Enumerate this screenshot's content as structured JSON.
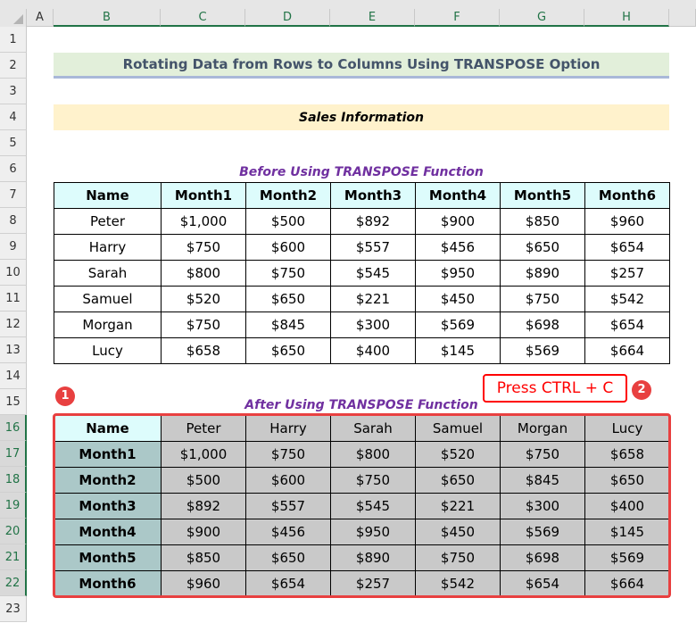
{
  "columns": [
    "A",
    "B",
    "C",
    "D",
    "E",
    "F",
    "G",
    "H"
  ],
  "rows": [
    "1",
    "2",
    "3",
    "4",
    "5",
    "6",
    "7",
    "8",
    "9",
    "10",
    "11",
    "12",
    "13",
    "14",
    "15",
    "16",
    "17",
    "18",
    "19",
    "20",
    "21",
    "22",
    "23"
  ],
  "title": "Rotating Data from Rows to Columns Using TRANSPOSE Option",
  "subtitle": "Sales Information",
  "before_caption": "Before Using TRANSPOSE Function",
  "after_caption": "After Using TRANSPOSE Function",
  "callout": "Press CTRL + C",
  "badges": [
    "1",
    "2"
  ],
  "colors": {
    "accent_red": "#e84040",
    "caption": "#7030a0",
    "header_bg": "#ddfcfc",
    "selected_bg": "#c9c9c9",
    "selected_first_col": "#abc8c8"
  },
  "before_table": {
    "headers": [
      "Name",
      "Month1",
      "Month2",
      "Month3",
      "Month4",
      "Month5",
      "Month6"
    ],
    "rows": [
      [
        "Peter",
        "$1,000",
        "$500",
        "$892",
        "$900",
        "$850",
        "$960"
      ],
      [
        "Harry",
        "$750",
        "$600",
        "$557",
        "$456",
        "$650",
        "$654"
      ],
      [
        "Sarah",
        "$800",
        "$750",
        "$545",
        "$950",
        "$890",
        "$257"
      ],
      [
        "Samuel",
        "$520",
        "$650",
        "$221",
        "$450",
        "$750",
        "$542"
      ],
      [
        "Morgan",
        "$750",
        "$845",
        "$300",
        "$569",
        "$698",
        "$654"
      ],
      [
        "Lucy",
        "$658",
        "$650",
        "$400",
        "$145",
        "$569",
        "$664"
      ]
    ]
  },
  "after_table": {
    "headers": [
      "Name",
      "Peter",
      "Harry",
      "Sarah",
      "Samuel",
      "Morgan",
      "Lucy"
    ],
    "rows": [
      [
        "Month1",
        "$1,000",
        "$750",
        "$800",
        "$520",
        "$750",
        "$658"
      ],
      [
        "Month2",
        "$500",
        "$600",
        "$750",
        "$650",
        "$845",
        "$650"
      ],
      [
        "Month3",
        "$892",
        "$557",
        "$545",
        "$221",
        "$300",
        "$400"
      ],
      [
        "Month4",
        "$900",
        "$456",
        "$950",
        "$450",
        "$569",
        "$145"
      ],
      [
        "Month5",
        "$850",
        "$650",
        "$890",
        "$750",
        "$698",
        "$569"
      ],
      [
        "Month6",
        "$960",
        "$654",
        "$257",
        "$542",
        "$654",
        "$664"
      ]
    ]
  }
}
